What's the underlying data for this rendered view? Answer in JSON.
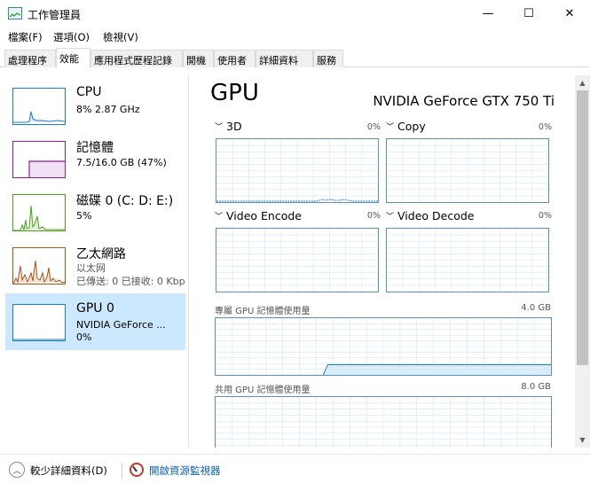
{
  "window": {
    "title": "工作管理員",
    "minimize": "—",
    "maximize": "☐",
    "close": "✕"
  },
  "menu": {
    "file": "檔案(F)",
    "options": "選項(O)",
    "view": "檢視(V)"
  },
  "tabs": [
    "處理程序",
    "效能",
    "應用程式歷程記錄",
    "開機",
    "使用者",
    "詳細資料",
    "服務"
  ],
  "active_tab": "效能",
  "sidebar": {
    "cpu": {
      "name": "CPU",
      "detail": "8%  2.87 GHz"
    },
    "memory": {
      "name": "記憶體",
      "detail": "7.5/16.0 GB (47%)"
    },
    "disk": {
      "name": "磁碟 0 (C: D: E:)",
      "detail": "5%"
    },
    "ethernet": {
      "name": "乙太網路",
      "detail1": "以太网",
      "detail2": "已傳送: 0 已接收: 0 Kbp"
    },
    "gpu": {
      "name": "GPU 0",
      "detail1": "NVIDIA GeForce ...",
      "detail2": "0%"
    }
  },
  "colors": {
    "cpu": "#1a7fc7",
    "memory": "#8b1e9b",
    "disk": "#4da01e",
    "ethernet": "#a8541a",
    "gpu": "#1a7fc7",
    "selected_bg": "#cce8ff",
    "graph_border": "#5a8fc8",
    "grid": "#d6e6f5"
  },
  "main": {
    "title": "GPU",
    "model": "NVIDIA GeForce GTX 750 Ti",
    "engines": [
      {
        "label": "3D",
        "pct": "0%"
      },
      {
        "label": "Copy",
        "pct": "0%"
      },
      {
        "label": "Video Encode",
        "pct": "0%"
      },
      {
        "label": "Video Decode",
        "pct": "0%"
      }
    ],
    "dedicated_label": "專屬 GPU 記憶體使用量",
    "dedicated_max": "4.0 GB",
    "dedicated_level": 0.18,
    "shared_label": "共用 GPU 記憶體使用量",
    "shared_max": "8.0 GB"
  },
  "footer": {
    "fewer_details": "較少詳細資料(D)",
    "open_resmon": "開啟資源監視器"
  },
  "icons": {
    "expand": "chevron-down-icon",
    "fewer": "chevron-up-icon",
    "resmon": "resource-monitor-icon"
  }
}
